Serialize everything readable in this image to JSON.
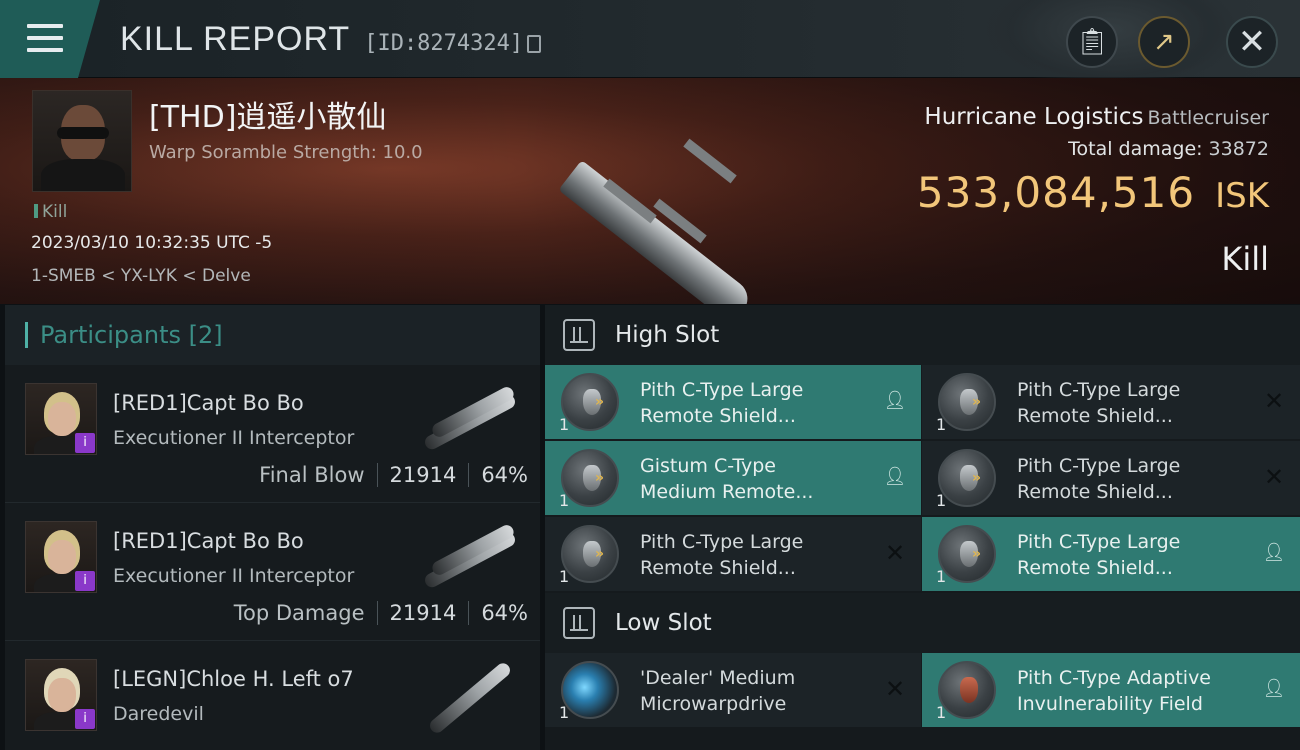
{
  "header": {
    "title": "KILL REPORT",
    "report_id": "[ID:8274324]"
  },
  "victim": {
    "name": "[THD]逍遥小散仙",
    "scramble": "Warp Soramble Strength: 10.0",
    "tag": "Kill",
    "datetime": "2023/03/10 10:32:35 UTC -5",
    "location": "1-SMEB < YX-LYK < Delve",
    "ship_name": "Hurricane Logistics",
    "ship_class": "Battlecruiser",
    "damage_label": "Total damage:",
    "damage_value": "33872",
    "isk_amount": "533,084,516",
    "isk_unit": "ISK",
    "result": "Kill"
  },
  "participants": {
    "header": "Participants [2]",
    "rows": [
      {
        "name": "[RED1]Capt Bo Bo",
        "ship": "Executioner II Interceptor",
        "role": "Final Blow",
        "damage": "21914",
        "percent": "64%"
      },
      {
        "name": "[RED1]Capt Bo Bo",
        "ship": "Executioner II Interceptor",
        "role": "Top Damage",
        "damage": "21914",
        "percent": "64%"
      },
      {
        "name": "[LEGN]Chloe H. Left o7",
        "ship": "Daredevil"
      }
    ]
  },
  "slots": {
    "high": {
      "label": "High Slot",
      "items": [
        {
          "line1": "Pith C-Type Large",
          "line2": "Remote Shield...",
          "qty": "1",
          "highlight": true,
          "status": "person"
        },
        {
          "line1": "Pith C-Type Large",
          "line2": "Remote Shield...",
          "qty": "1",
          "highlight": false,
          "status": "x"
        },
        {
          "line1": "Gistum C-Type",
          "line2": "Medium Remote...",
          "qty": "1",
          "highlight": true,
          "status": "person"
        },
        {
          "line1": "Pith C-Type Large",
          "line2": "Remote Shield...",
          "qty": "1",
          "highlight": false,
          "status": "x"
        },
        {
          "line1": "Pith C-Type Large",
          "line2": "Remote Shield...",
          "qty": "1",
          "highlight": false,
          "status": "x"
        },
        {
          "line1": "Pith C-Type Large",
          "line2": "Remote Shield...",
          "qty": "1",
          "highlight": true,
          "status": "person"
        }
      ]
    },
    "low": {
      "label": "Low Slot",
      "items": [
        {
          "line1": "'Dealer' Medium",
          "line2": "Microwarpdrive",
          "qty": "1",
          "highlight": false,
          "status": "x"
        },
        {
          "line1": "Pith C-Type Adaptive",
          "line2": "Invulnerability Field",
          "qty": "1",
          "highlight": true,
          "status": "person"
        }
      ]
    }
  },
  "colors": {
    "accent": "#2f7a72",
    "isk": "#f2c67a",
    "participants_header": "#3b8e86"
  },
  "icons": {
    "menu": "hamburger-icon",
    "copy": "copy-icon",
    "clipboard": "clipboard-icon",
    "share": "share-icon",
    "close": "close-icon"
  }
}
